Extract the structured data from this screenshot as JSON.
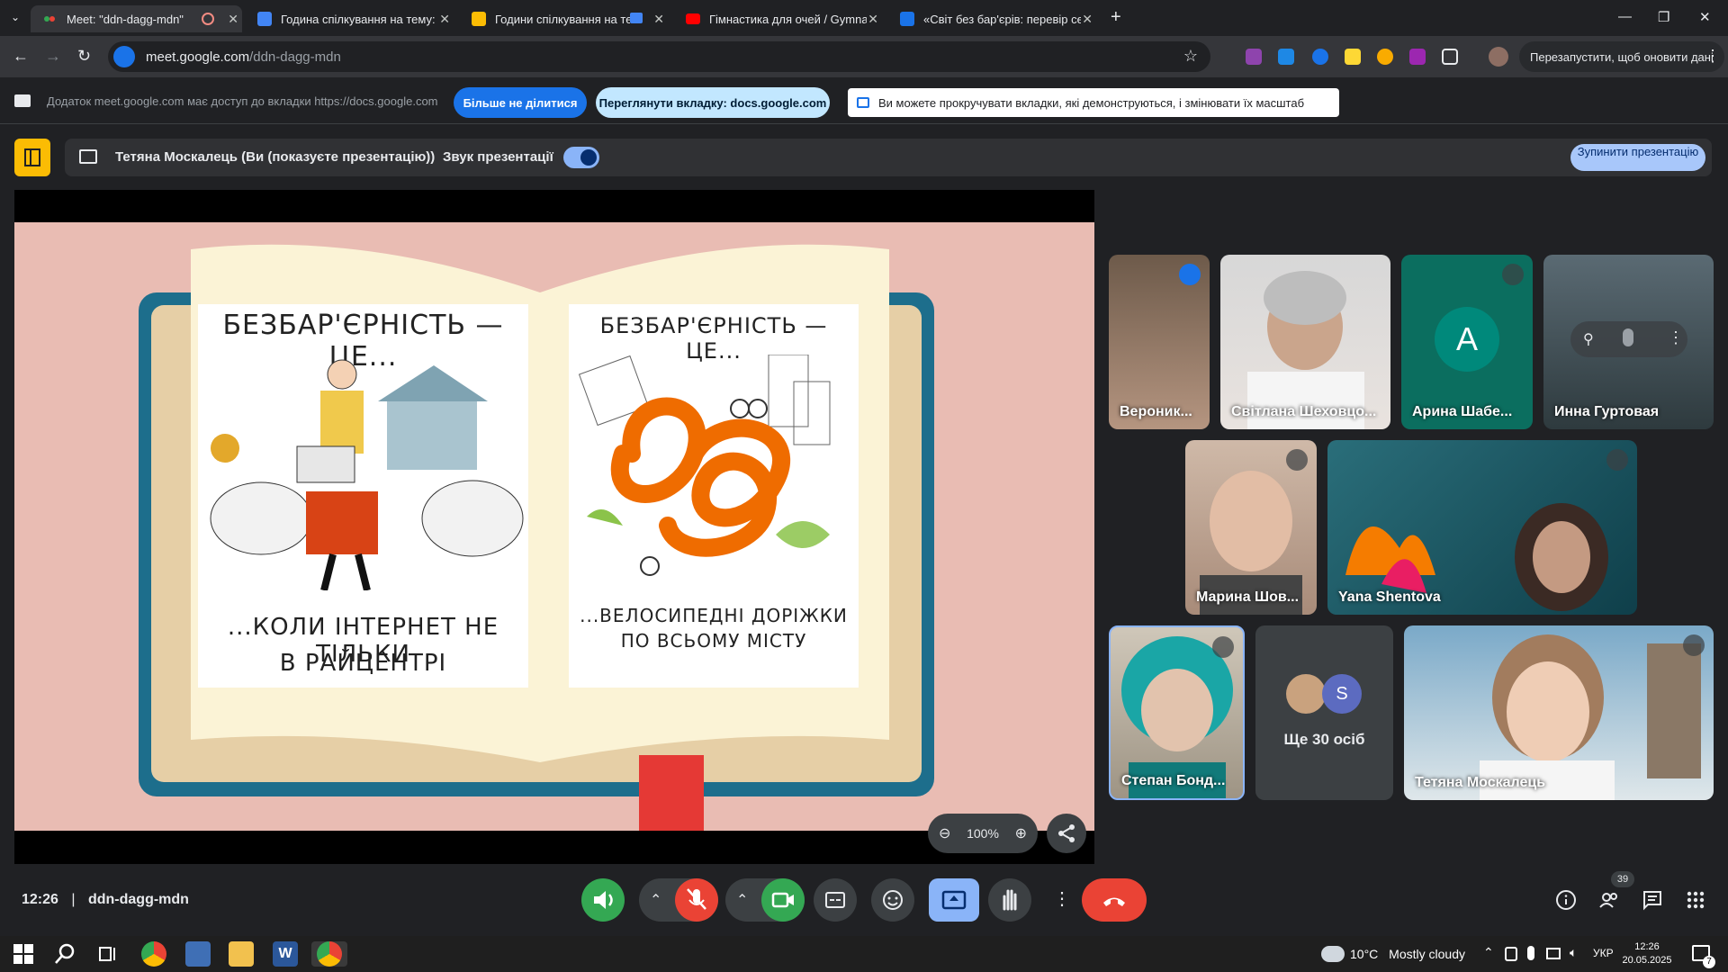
{
  "browser": {
    "tabs": [
      {
        "title": "Meet: \"ddn-dagg-mdn\"",
        "icon": "meet-icon",
        "color": "#34a853"
      },
      {
        "title": "Година спілкування на тему: «",
        "icon": "docs-icon",
        "color": "#4285f4"
      },
      {
        "title": "Години спілкування на тем",
        "icon": "slides-icon",
        "color": "#fbbc04"
      },
      {
        "title": "Гімнастика для очей / Gymnas",
        "icon": "youtube-icon",
        "color": "#ff0000"
      },
      {
        "title": "«Світ без бар'єрів: перевір се",
        "icon": "puzzle-icon",
        "color": "#1a73e8"
      }
    ],
    "url_host": "meet.google.com",
    "url_path": "/ddn-dagg-mdn",
    "restart_label": "Перезапустити, щоб оновити дані"
  },
  "infobar": {
    "message": "Додаток meet.google.com має доступ до вкладки https://docs.google.com",
    "stop_share_label": "Більше не ділитися",
    "view_tab_label": "Переглянути вкладку: docs.google.com",
    "tip": "Ви можете прокручувати вкладки, які демонструються, і змінювати їх масштаб"
  },
  "presenting": {
    "presenter": "Тетяна Москалець (Ви (показуєте презентацію))",
    "sound_label": "Звук презентації",
    "sound_on": true,
    "stop_label": "Зупинити презентацію"
  },
  "slide": {
    "left_title": "БЕЗБАР'ЄРНІСТЬ — ЦЕ...",
    "left_caption_1": "...КОЛИ ІНТЕРНЕТ НЕ ТІЛЬКИ",
    "left_caption_2": "В РАЙЦЕНТРІ",
    "right_title": "БЕЗБАР'ЄРНІСТЬ — ЦЕ...",
    "right_caption_1": "...ВЕЛОСИПЕДНІ ДОРІЖКИ",
    "right_caption_2": "ПО ВСЬОМУ МІСТУ",
    "zoom": "100%"
  },
  "participants": [
    {
      "name": "Вероник...",
      "speaking": true
    },
    {
      "name": "Світлана Шеховцо..."
    },
    {
      "name": "Арина Шабе...",
      "initial": "А",
      "muted": true
    },
    {
      "name": "Инна Гуртовая"
    },
    {
      "name": "Марина Шов...",
      "muted": true
    },
    {
      "name": "Yana Shentova",
      "muted": true
    },
    {
      "name": "Степан Бонд...",
      "muted": true
    },
    {
      "name": "Ще 30 осіб",
      "initial": "S"
    },
    {
      "name": "Тетяна Москалець",
      "muted": true
    }
  ],
  "meeting": {
    "time": "12:26",
    "code": "ddn-dagg-mdn",
    "people_count": "39"
  },
  "taskbar": {
    "temp": "10°C",
    "weather": "Mostly cloudy",
    "lang": "УКР",
    "time": "12:26",
    "date": "20.05.2025",
    "notif": "7"
  }
}
